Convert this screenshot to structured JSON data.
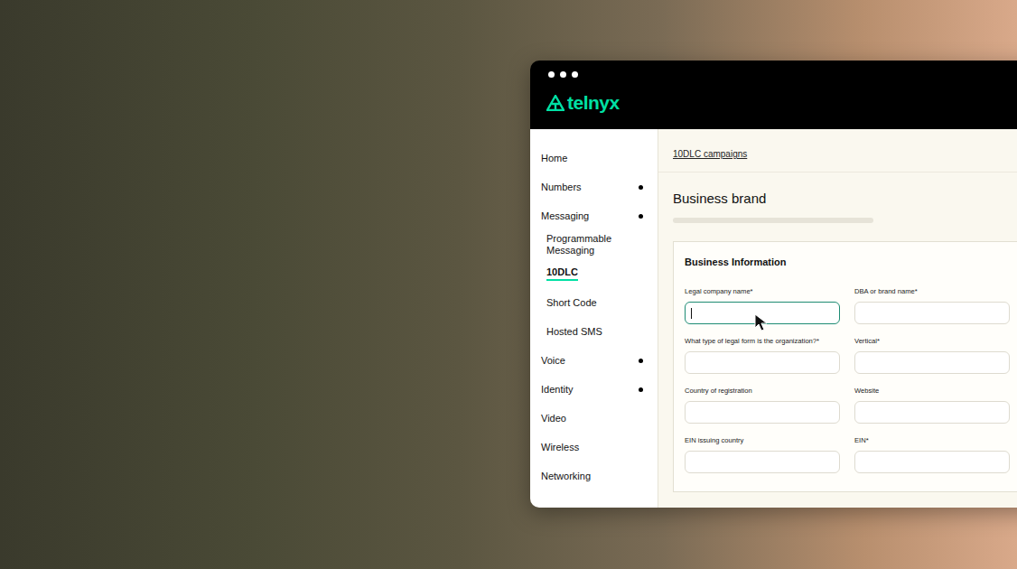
{
  "app": {
    "logo": "telnyx"
  },
  "sidebar": {
    "items": [
      {
        "label": "Home",
        "kind": "top",
        "expandable": false,
        "selected": false
      },
      {
        "label": "Numbers",
        "kind": "top",
        "expandable": true,
        "selected": false
      },
      {
        "label": "Messaging",
        "kind": "top",
        "expandable": true,
        "selected": false
      },
      {
        "label": "Programmable Messaging",
        "kind": "sub",
        "expandable": false,
        "selected": false
      },
      {
        "label": "10DLC",
        "kind": "sub",
        "expandable": false,
        "selected": true
      },
      {
        "label": "Short Code",
        "kind": "sub",
        "expandable": false,
        "selected": false
      },
      {
        "label": "Hosted SMS",
        "kind": "sub",
        "expandable": false,
        "selected": false
      },
      {
        "label": "Voice",
        "kind": "top",
        "expandable": true,
        "selected": false
      },
      {
        "label": "Identity",
        "kind": "top",
        "expandable": true,
        "selected": false
      },
      {
        "label": "Video",
        "kind": "top",
        "expandable": false,
        "selected": false
      },
      {
        "label": "Wireless",
        "kind": "top",
        "expandable": false,
        "selected": false
      },
      {
        "label": "Networking",
        "kind": "top",
        "expandable": false,
        "selected": false
      }
    ]
  },
  "breadcrumb": "10DLC campaigns",
  "page": {
    "title": "Business brand"
  },
  "form": {
    "title": "Business Information",
    "fields": [
      {
        "label": "Legal company name*",
        "value": "",
        "focused": true
      },
      {
        "label": "DBA or brand name*",
        "value": "",
        "focused": false
      },
      {
        "label": "What type of legal form is the organization?*",
        "value": "",
        "focused": false
      },
      {
        "label": "Vertical*",
        "value": "",
        "focused": false
      },
      {
        "label": "Country of registration",
        "value": "",
        "focused": false
      },
      {
        "label": "Website",
        "value": "",
        "focused": false
      },
      {
        "label": "EIN issuing country",
        "value": "",
        "focused": false
      },
      {
        "label": "EIN*",
        "value": "",
        "focused": false
      }
    ]
  }
}
